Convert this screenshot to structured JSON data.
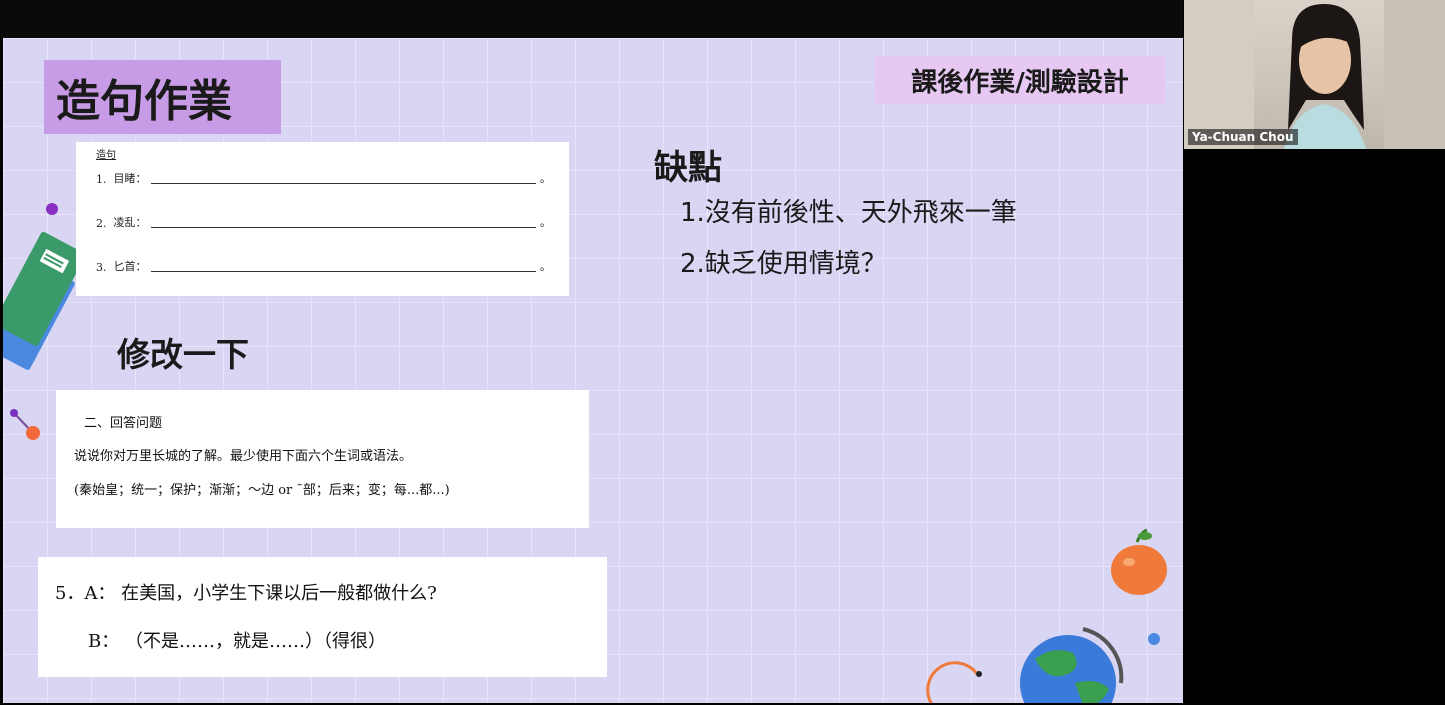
{
  "slide": {
    "title": "造句作業",
    "section_tag": "課後作業/測驗設計",
    "worksheet1": {
      "header": "造句",
      "items": [
        {
          "num": "1.",
          "word": "目睹："
        },
        {
          "num": "2.",
          "word": "凌乱："
        },
        {
          "num": "3.",
          "word": "匕首："
        }
      ],
      "end_mark": "。"
    },
    "revise_heading": "修改一下",
    "worksheet2": {
      "line1": "二、回答问题",
      "line2": "说说你对万里长城的了解。最少使用下面六个生词或语法。",
      "line3": "(秦始皇；统一；保护；渐渐；～边 or ˜部；后来；变；每...都...)"
    },
    "worksheet3": {
      "line1": "5．A： 在美国，小学生下课以后一般都做什么?",
      "line2": "B： （不是……，就是……）（得很）"
    },
    "cons_title": "缺點",
    "cons_items": [
      "1.沒有前後性、天外飛來一筆",
      "2.缺乏使用情境？"
    ]
  },
  "video": {
    "participant_name": "Ya-Chuan Chou"
  },
  "toolbar": {
    "icons": [
      "back-icon",
      "pen-icon",
      "zoom-icon",
      "cc-icon",
      "video-icon",
      "more-icon",
      "forward-icon"
    ]
  },
  "colors": {
    "slide_bg": "#d9d6f4",
    "title_bg": "#c89be6",
    "tag_bg": "#e6c8f2"
  }
}
